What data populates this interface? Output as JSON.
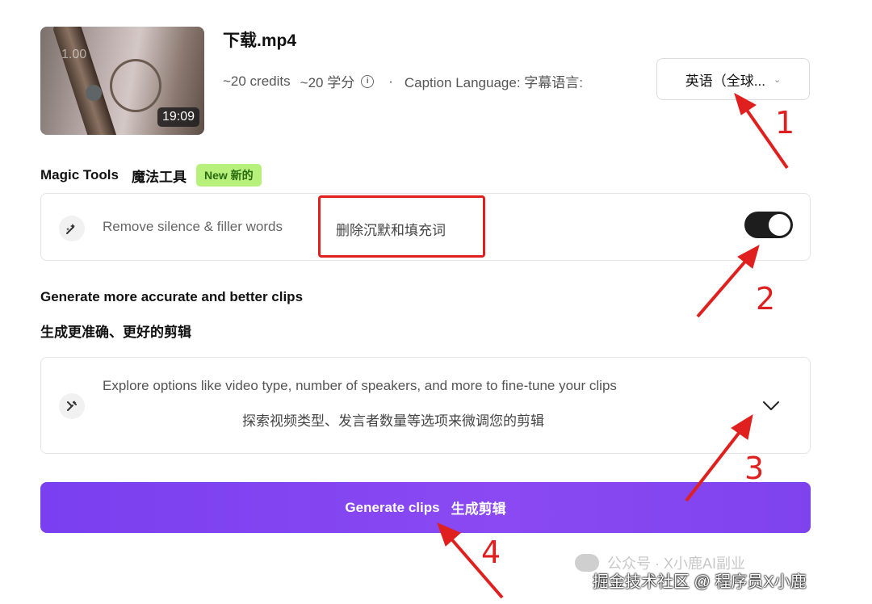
{
  "video": {
    "filename": "下载.mp4",
    "speed_overlay": "1.00",
    "duration": "19:09",
    "credits_en": "~20 credits",
    "credits_cn": "~20 学分",
    "info_icon": "info-icon",
    "separator": "·",
    "caption_label": "Caption Language: 字幕语言:",
    "caption_value": "英语（全球...",
    "chevron": "⌄"
  },
  "magic_tools": {
    "title": "Magic Tools",
    "title_cn": "魔法工具",
    "badge": "New 新的",
    "badge_color": "#b7f07a",
    "remove_label": "Remove silence & filler words",
    "remove_label_cn": "删除沉默和填充词",
    "toggle_on": true
  },
  "generate_section": {
    "title": "Generate more accurate and better clips",
    "title_cn": "生成更准确、更好的剪辑",
    "explore_en": "Explore options like video type, number of speakers, and more to fine-tune your clips",
    "explore_cn": "探索视频类型、发言者数量等选项来微调您的剪辑"
  },
  "button": {
    "label": "Generate clips",
    "label_cn": "生成剪辑",
    "color": "#7f43ee"
  },
  "annotations": {
    "n1": "1",
    "n2": "2",
    "n3": "3",
    "n4": "4",
    "color": "#e0201e"
  },
  "watermark": {
    "line1": "公众号 · X小鹿AI副业",
    "line2": "掘金技术社区 @ 程序员X小鹿"
  }
}
